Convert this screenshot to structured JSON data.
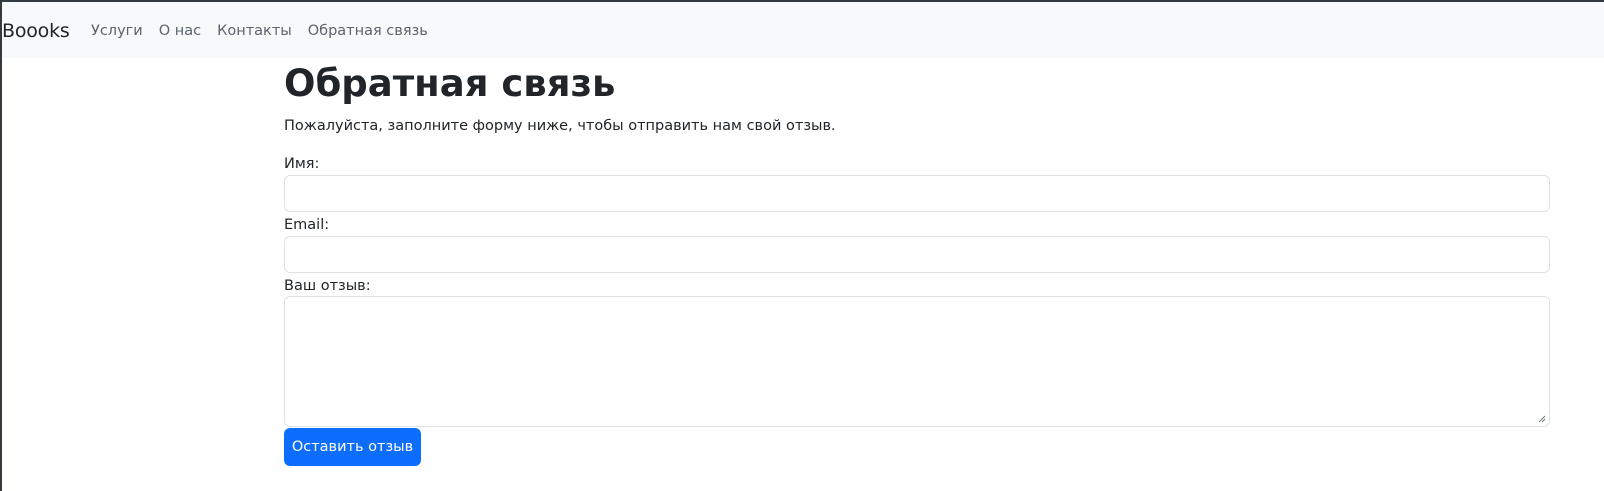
{
  "navbar": {
    "brand": "Boooks",
    "links": [
      {
        "label": "Услуги"
      },
      {
        "label": "О нас"
      },
      {
        "label": "Контакты"
      },
      {
        "label": "Обратная связь"
      }
    ]
  },
  "main": {
    "title": "Обратная связь",
    "lead": "Пожалуйста, заполните форму ниже, чтобы отправить нам свой отзыв.",
    "form": {
      "name_label": "Имя:",
      "email_label": "Email:",
      "review_label": "Ваш отзыв:",
      "name_value": "",
      "email_value": "",
      "review_value": "",
      "submit_label": "Оставить отзыв"
    }
  },
  "colors": {
    "primary": "#0d6efd",
    "navbar_bg": "#f8f9fa",
    "text": "#212529",
    "nav_text": "#5c636a"
  }
}
